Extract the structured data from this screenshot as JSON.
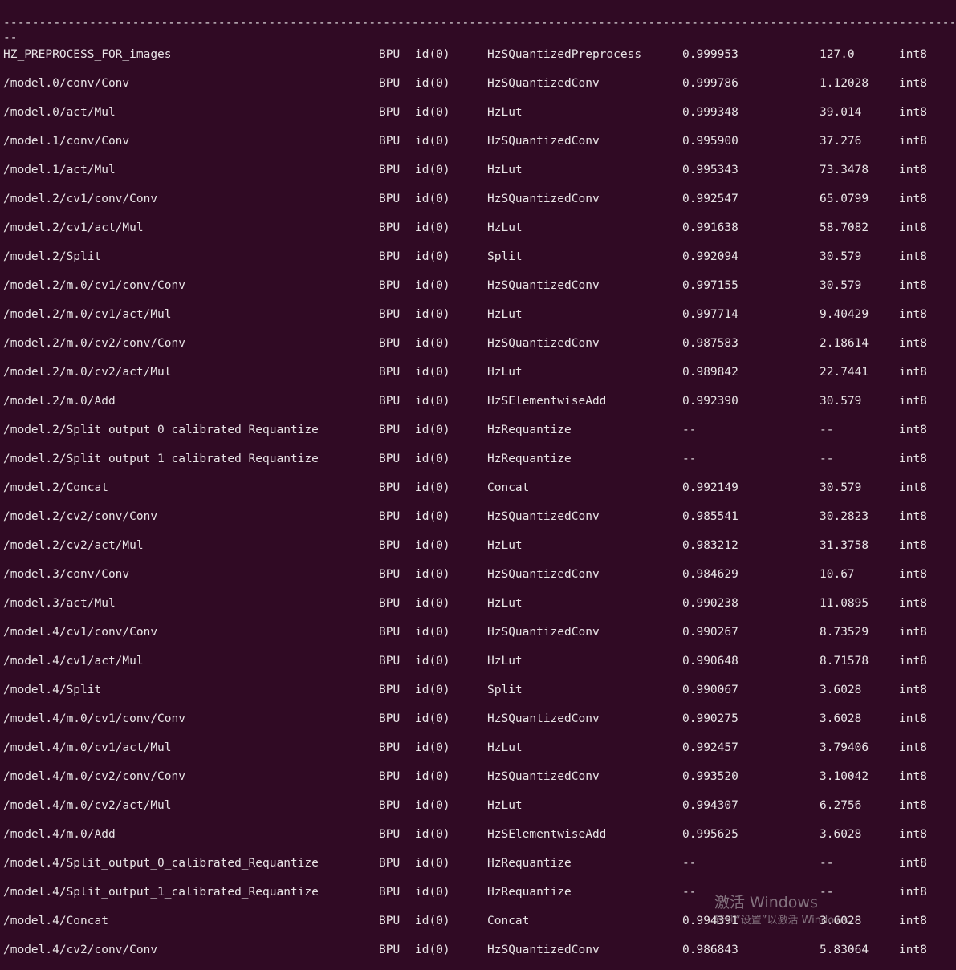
{
  "terminal": {
    "background": "#300a24",
    "foreground": "#e8e4e6",
    "separator_line": "--------------------------------------------------------------------------------------------------------------------------------------------------------------------------------------------------------------------------------------------",
    "separator_tail": "--"
  },
  "rows": [
    {
      "name": "HZ_PREPROCESS_FOR_images",
      "device": "BPU",
      "id": "id(0)",
      "type": "HzSQuantizedPreprocess",
      "similarity": "0.999953",
      "threshold": "127.0",
      "dtype": "int8"
    },
    {
      "name": "/model.0/conv/Conv",
      "device": "BPU",
      "id": "id(0)",
      "type": "HzSQuantizedConv",
      "similarity": "0.999786",
      "threshold": "1.12028",
      "dtype": "int8"
    },
    {
      "name": "/model.0/act/Mul",
      "device": "BPU",
      "id": "id(0)",
      "type": "HzLut",
      "similarity": "0.999348",
      "threshold": "39.014",
      "dtype": "int8"
    },
    {
      "name": "/model.1/conv/Conv",
      "device": "BPU",
      "id": "id(0)",
      "type": "HzSQuantizedConv",
      "similarity": "0.995900",
      "threshold": "37.276",
      "dtype": "int8"
    },
    {
      "name": "/model.1/act/Mul",
      "device": "BPU",
      "id": "id(0)",
      "type": "HzLut",
      "similarity": "0.995343",
      "threshold": "73.3478",
      "dtype": "int8"
    },
    {
      "name": "/model.2/cv1/conv/Conv",
      "device": "BPU",
      "id": "id(0)",
      "type": "HzSQuantizedConv",
      "similarity": "0.992547",
      "threshold": "65.0799",
      "dtype": "int8"
    },
    {
      "name": "/model.2/cv1/act/Mul",
      "device": "BPU",
      "id": "id(0)",
      "type": "HzLut",
      "similarity": "0.991638",
      "threshold": "58.7082",
      "dtype": "int8"
    },
    {
      "name": "/model.2/Split",
      "device": "BPU",
      "id": "id(0)",
      "type": "Split",
      "similarity": "0.992094",
      "threshold": "30.579",
      "dtype": "int8"
    },
    {
      "name": "/model.2/m.0/cv1/conv/Conv",
      "device": "BPU",
      "id": "id(0)",
      "type": "HzSQuantizedConv",
      "similarity": "0.997155",
      "threshold": "30.579",
      "dtype": "int8"
    },
    {
      "name": "/model.2/m.0/cv1/act/Mul",
      "device": "BPU",
      "id": "id(0)",
      "type": "HzLut",
      "similarity": "0.997714",
      "threshold": "9.40429",
      "dtype": "int8"
    },
    {
      "name": "/model.2/m.0/cv2/conv/Conv",
      "device": "BPU",
      "id": "id(0)",
      "type": "HzSQuantizedConv",
      "similarity": "0.987583",
      "threshold": "2.18614",
      "dtype": "int8"
    },
    {
      "name": "/model.2/m.0/cv2/act/Mul",
      "device": "BPU",
      "id": "id(0)",
      "type": "HzLut",
      "similarity": "0.989842",
      "threshold": "22.7441",
      "dtype": "int8"
    },
    {
      "name": "/model.2/m.0/Add",
      "device": "BPU",
      "id": "id(0)",
      "type": "HzSElementwiseAdd",
      "similarity": "0.992390",
      "threshold": "30.579",
      "dtype": "int8"
    },
    {
      "name": "/model.2/Split_output_0_calibrated_Requantize",
      "device": "BPU",
      "id": "id(0)",
      "type": "HzRequantize",
      "similarity": "--",
      "threshold": "--",
      "dtype": "int8"
    },
    {
      "name": "/model.2/Split_output_1_calibrated_Requantize",
      "device": "BPU",
      "id": "id(0)",
      "type": "HzRequantize",
      "similarity": "--",
      "threshold": "--",
      "dtype": "int8"
    },
    {
      "name": "/model.2/Concat",
      "device": "BPU",
      "id": "id(0)",
      "type": "Concat",
      "similarity": "0.992149",
      "threshold": "30.579",
      "dtype": "int8"
    },
    {
      "name": "/model.2/cv2/conv/Conv",
      "device": "BPU",
      "id": "id(0)",
      "type": "HzSQuantizedConv",
      "similarity": "0.985541",
      "threshold": "30.2823",
      "dtype": "int8"
    },
    {
      "name": "/model.2/cv2/act/Mul",
      "device": "BPU",
      "id": "id(0)",
      "type": "HzLut",
      "similarity": "0.983212",
      "threshold": "31.3758",
      "dtype": "int8"
    },
    {
      "name": "/model.3/conv/Conv",
      "device": "BPU",
      "id": "id(0)",
      "type": "HzSQuantizedConv",
      "similarity": "0.984629",
      "threshold": "10.67",
      "dtype": "int8"
    },
    {
      "name": "/model.3/act/Mul",
      "device": "BPU",
      "id": "id(0)",
      "type": "HzLut",
      "similarity": "0.990238",
      "threshold": "11.0895",
      "dtype": "int8"
    },
    {
      "name": "/model.4/cv1/conv/Conv",
      "device": "BPU",
      "id": "id(0)",
      "type": "HzSQuantizedConv",
      "similarity": "0.990267",
      "threshold": "8.73529",
      "dtype": "int8"
    },
    {
      "name": "/model.4/cv1/act/Mul",
      "device": "BPU",
      "id": "id(0)",
      "type": "HzLut",
      "similarity": "0.990648",
      "threshold": "8.71578",
      "dtype": "int8"
    },
    {
      "name": "/model.4/Split",
      "device": "BPU",
      "id": "id(0)",
      "type": "Split",
      "similarity": "0.990067",
      "threshold": "3.6028",
      "dtype": "int8"
    },
    {
      "name": "/model.4/m.0/cv1/conv/Conv",
      "device": "BPU",
      "id": "id(0)",
      "type": "HzSQuantizedConv",
      "similarity": "0.990275",
      "threshold": "3.6028",
      "dtype": "int8"
    },
    {
      "name": "/model.4/m.0/cv1/act/Mul",
      "device": "BPU",
      "id": "id(0)",
      "type": "HzLut",
      "similarity": "0.992457",
      "threshold": "3.79406",
      "dtype": "int8"
    },
    {
      "name": "/model.4/m.0/cv2/conv/Conv",
      "device": "BPU",
      "id": "id(0)",
      "type": "HzSQuantizedConv",
      "similarity": "0.993520",
      "threshold": "3.10042",
      "dtype": "int8"
    },
    {
      "name": "/model.4/m.0/cv2/act/Mul",
      "device": "BPU",
      "id": "id(0)",
      "type": "HzLut",
      "similarity": "0.994307",
      "threshold": "6.2756",
      "dtype": "int8"
    },
    {
      "name": "/model.4/m.0/Add",
      "device": "BPU",
      "id": "id(0)",
      "type": "HzSElementwiseAdd",
      "similarity": "0.995625",
      "threshold": "3.6028",
      "dtype": "int8"
    },
    {
      "name": "/model.4/Split_output_0_calibrated_Requantize",
      "device": "BPU",
      "id": "id(0)",
      "type": "HzRequantize",
      "similarity": "--",
      "threshold": "--",
      "dtype": "int8"
    },
    {
      "name": "/model.4/Split_output_1_calibrated_Requantize",
      "device": "BPU",
      "id": "id(0)",
      "type": "HzRequantize",
      "similarity": "--",
      "threshold": "--",
      "dtype": "int8"
    },
    {
      "name": "/model.4/Concat",
      "device": "BPU",
      "id": "id(0)",
      "type": "Concat",
      "similarity": "0.994391",
      "threshold": "3.6028",
      "dtype": "int8"
    },
    {
      "name": "/model.4/cv2/conv/Conv",
      "device": "BPU",
      "id": "id(0)",
      "type": "HzSQuantizedConv",
      "similarity": "0.986843",
      "threshold": "5.83064",
      "dtype": "int8"
    }
  ],
  "watermark": {
    "title": "激活 Windows",
    "subtitle": "转到“设置”以激活 Windows。"
  }
}
